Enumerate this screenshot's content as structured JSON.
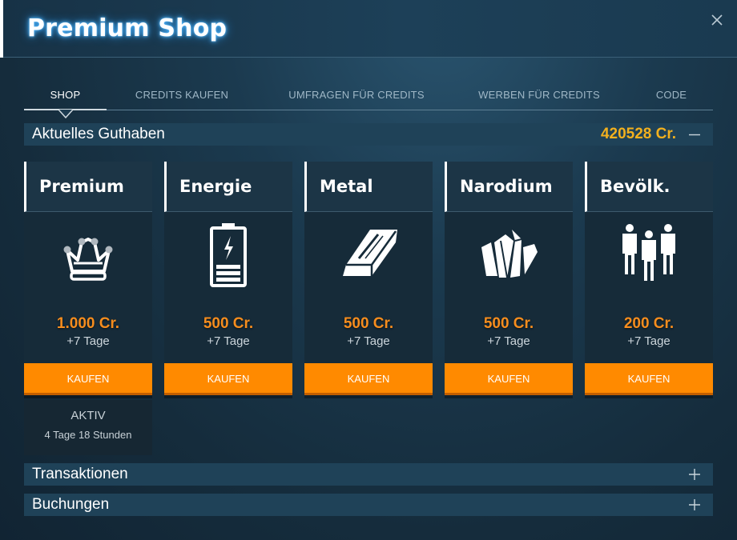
{
  "window": {
    "title": "Premium Shop",
    "close_icon": "close-icon"
  },
  "tabs": [
    {
      "label": "SHOP",
      "active": true
    },
    {
      "label": "CREDITS KAUFEN",
      "active": false
    },
    {
      "label": "UMFRAGEN FÜR CREDITS",
      "active": false
    },
    {
      "label": "WERBEN FÜR CREDITS",
      "active": false
    },
    {
      "label": "CODE",
      "active": false
    }
  ],
  "balance": {
    "label": "Aktuelles Guthaben",
    "amount": "420528 Cr.",
    "toggle_icon": "minus-icon"
  },
  "cards": [
    {
      "name": "Premium",
      "icon": "crown-icon",
      "price": "1.000 Cr.",
      "duration": "+7 Tage",
      "buy_label": "KAUFEN"
    },
    {
      "name": "Energie",
      "icon": "battery-icon",
      "price": "500 Cr.",
      "duration": "+7 Tage",
      "buy_label": "KAUFEN"
    },
    {
      "name": "Metal",
      "icon": "metal-bar-icon",
      "price": "500 Cr.",
      "duration": "+7 Tage",
      "buy_label": "KAUFEN"
    },
    {
      "name": "Narodium",
      "icon": "crystal-icon",
      "price": "500 Cr.",
      "duration": "+7 Tage",
      "buy_label": "KAUFEN"
    },
    {
      "name": "Bevölk.",
      "icon": "people-icon",
      "price": "200 Cr.",
      "duration": "+7 Tage",
      "buy_label": "KAUFEN"
    }
  ],
  "premium_status": {
    "status": "AKTIV",
    "remaining": "4 Tage 18 Stunden"
  },
  "sections": [
    {
      "label": "Transaktionen",
      "toggle_icon": "plus-icon"
    },
    {
      "label": "Buchungen",
      "toggle_icon": "plus-icon"
    }
  ],
  "colors": {
    "accent_orange": "#ff8a00",
    "price_orange": "#f68d1e",
    "balance_gold": "#f2b01e",
    "title_glow": "#52b8ff"
  }
}
